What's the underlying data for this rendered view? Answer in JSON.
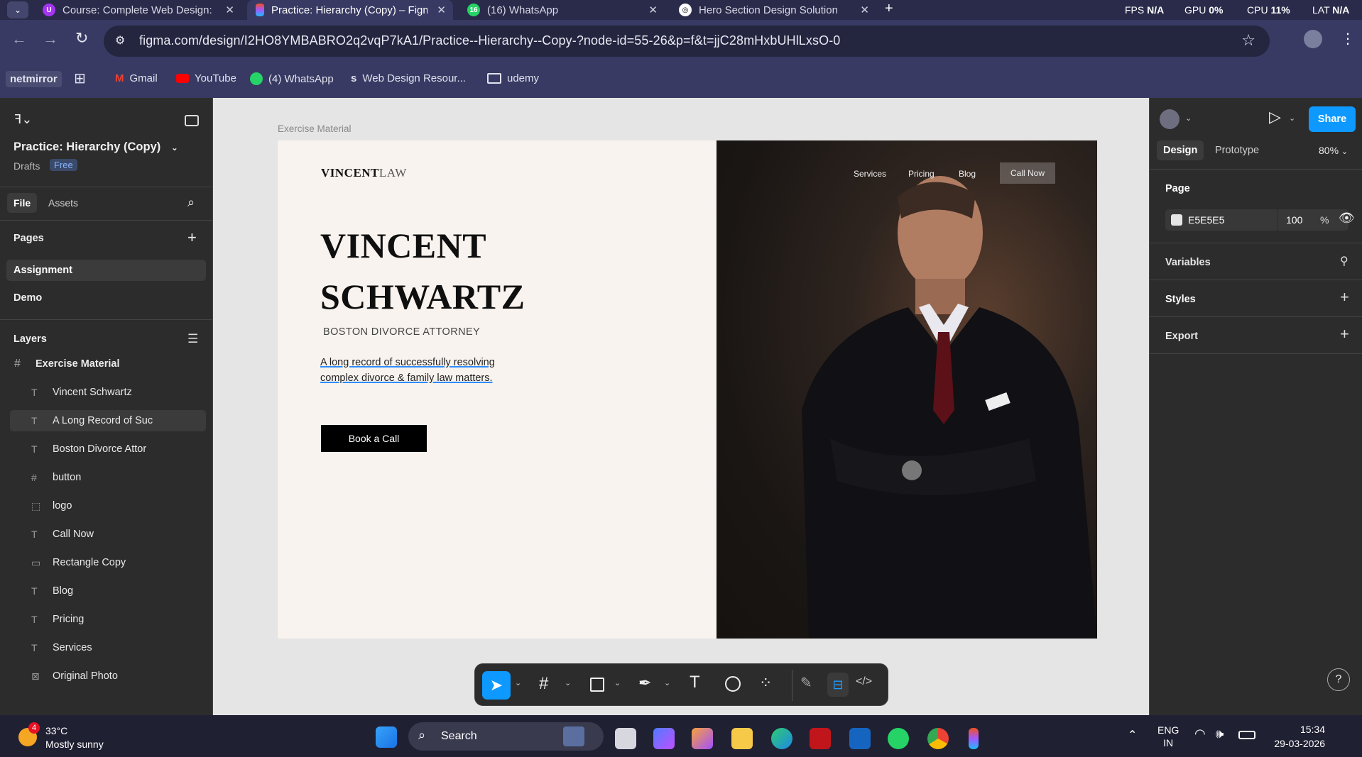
{
  "browser": {
    "tabs": [
      {
        "title": "Course: Complete Web Design:",
        "active": false
      },
      {
        "title": "Practice: Hierarchy (Copy) – Figm",
        "active": true
      },
      {
        "title": "(16) WhatsApp",
        "badge": "16",
        "active": false
      },
      {
        "title": "Hero Section Design Solution",
        "active": false
      }
    ],
    "new_tab": "+",
    "stats": {
      "fps_label": "FPS",
      "fps": "N/A",
      "gpu_label": "GPU",
      "gpu": "0%",
      "cpu_label": "CPU",
      "cpu": "11%",
      "lat_label": "LAT",
      "lat": "N/A"
    },
    "url": "figma.com/design/I2HO8YMBABRO2q2vqP7kA1/Practice--Hierarchy--Copy-?node-id=55-26&p=f&t=jjC28mHxbUHlLxsO-0",
    "bookmarks": [
      "netmirror",
      "Gmail",
      "YouTube",
      "(4) WhatsApp",
      "Web Design Resour...",
      "udemy"
    ]
  },
  "figma": {
    "file_title": "Practice: Hierarchy (Copy)",
    "drafts": "Drafts",
    "plan_badge": "Free",
    "tabs": [
      "File",
      "Assets"
    ],
    "pages_heading": "Pages",
    "pages": [
      "Assignment",
      "Demo"
    ],
    "layers_heading": "Layers",
    "frame_layer": "Exercise Material",
    "layers": [
      {
        "name": "Vincent Schwartz",
        "type": "text"
      },
      {
        "name": "A Long Record of Suc",
        "type": "text",
        "selected": true
      },
      {
        "name": "Boston Divorce Attor",
        "type": "text"
      },
      {
        "name": "button",
        "type": "frame"
      },
      {
        "name": "logo",
        "type": "group"
      },
      {
        "name": "Call Now",
        "type": "text"
      },
      {
        "name": "Rectangle Copy",
        "type": "rect"
      },
      {
        "name": "Blog",
        "type": "text"
      },
      {
        "name": "Pricing",
        "type": "text"
      },
      {
        "name": "Services",
        "type": "text"
      },
      {
        "name": "Original Photo",
        "type": "image"
      }
    ],
    "right": {
      "share": "Share",
      "tabs": [
        "Design",
        "Prototype"
      ],
      "zoom": "80%",
      "page_heading": "Page",
      "page_color": "E5E5E5",
      "opacity": "100",
      "opacity_unit": "%",
      "sections": [
        "Variables",
        "Styles",
        "Export"
      ],
      "help": "?"
    },
    "canvas": {
      "frame_label": "Exercise Material",
      "logo_bold": "VINCENT",
      "logo_light": "LAW",
      "headline_line1": "VINCENT",
      "headline_line2": "SCHWARTZ",
      "subtitle": "BOSTON DIVORCE ATTORNEY",
      "body_line1": "A long record of successfully resolving",
      "body_line2": "complex divorce & family law matters.",
      "cta": "Book a Call",
      "nav": [
        "Services",
        "Pricing",
        "Blog"
      ],
      "nav_cta": "Call Now"
    }
  },
  "taskbar": {
    "weather_temp": "33°C",
    "weather_desc": "Mostly sunny",
    "weather_badge": "4",
    "search": "Search",
    "lang1": "ENG",
    "lang2": "IN",
    "time": "15:34",
    "date": "29-03-2026"
  }
}
